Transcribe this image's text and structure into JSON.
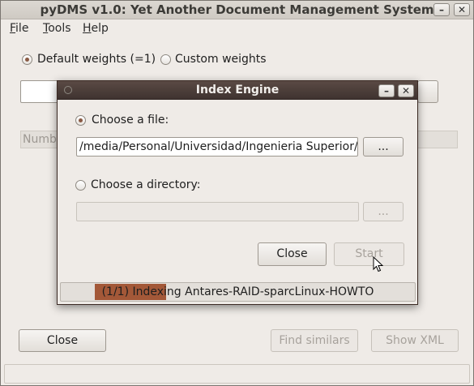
{
  "main_window": {
    "title": "pyDMS v1.0: Yet Another Document Management System",
    "menu": [
      {
        "label_first": "F",
        "label_rest": "ile"
      },
      {
        "label_first": "T",
        "label_rest": "ools"
      },
      {
        "label_first": "H",
        "label_rest": "elp"
      }
    ],
    "weights": {
      "default_label": "Default weights (=1)",
      "custom_label": "Custom weights",
      "selected": "default"
    },
    "column_header_partial": "Numbe",
    "buttons": {
      "close": "Close",
      "find_similars": "Find similars",
      "show_xml": "Show XML"
    }
  },
  "dialog": {
    "title": "Index Engine",
    "choose_file_label": "Choose a file:",
    "file_path_value": "/media/Personal/Universidad/Ingenieria Superior/isi-p",
    "browse_label": "...",
    "choose_directory_label": "Choose a directory:",
    "directory_value": "",
    "directory_browse_label": "...",
    "selected_option": "file",
    "close_label": "Close",
    "start_label": "Start",
    "progress": {
      "text": "(1/1) Indexing Antares-RAID-sparcLinux-HOWTO"
    }
  }
}
